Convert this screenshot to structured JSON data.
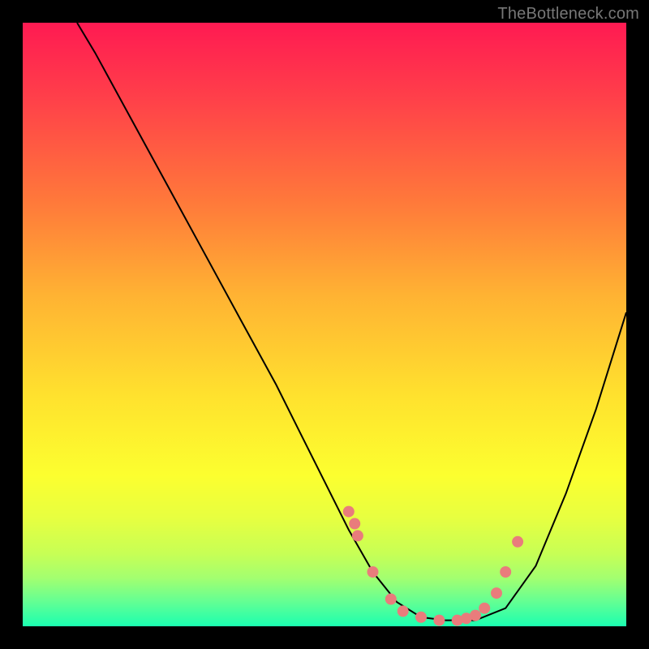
{
  "watermark": "TheBottleneck.com",
  "colors": {
    "background": "#000000",
    "dot": "#e97c7c",
    "curve": "#000000"
  },
  "chart_data": {
    "type": "line",
    "title": "",
    "xlabel": "",
    "ylabel": "",
    "xlim": [
      0,
      100
    ],
    "ylim": [
      0,
      100
    ],
    "curve": {
      "x": [
        9,
        12,
        18,
        24,
        30,
        36,
        42,
        46,
        50,
        54,
        58,
        62,
        66,
        70,
        75,
        80,
        85,
        90,
        95,
        100
      ],
      "y": [
        100,
        95,
        84,
        73,
        62,
        51,
        40,
        32,
        24,
        16,
        9,
        4,
        1.5,
        1,
        1,
        3,
        10,
        22,
        36,
        52
      ]
    },
    "series": [
      {
        "name": "markers",
        "x": [
          54,
          55,
          55.5,
          58,
          61,
          63,
          66,
          69,
          72,
          73.5,
          75,
          76.5,
          78.5,
          80,
          82
        ],
        "y": [
          19,
          17,
          15,
          9,
          4.5,
          2.5,
          1.5,
          1,
          1,
          1.3,
          1.8,
          3,
          5.5,
          9,
          14
        ]
      }
    ]
  }
}
